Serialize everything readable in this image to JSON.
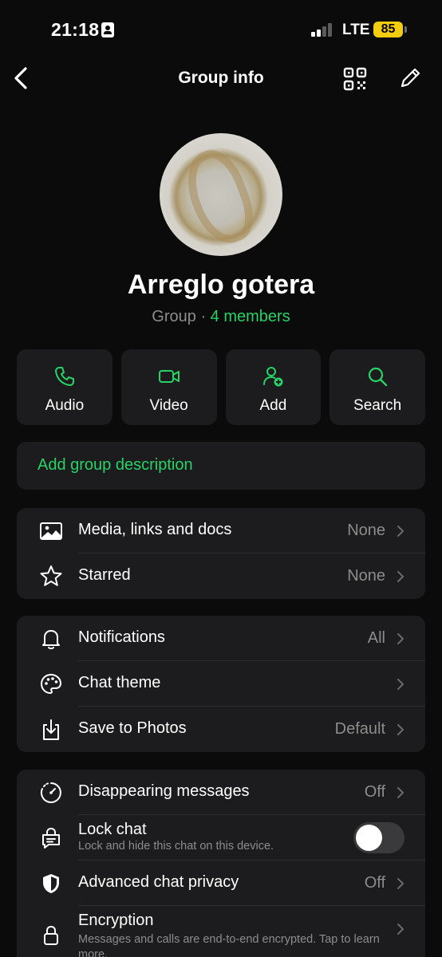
{
  "status_bar": {
    "time": "21:18",
    "network": "LTE",
    "battery": "85"
  },
  "header": {
    "title": "Group info"
  },
  "group": {
    "name": "Arreglo gotera",
    "type": "Group",
    "separator": "·",
    "members": "4 members"
  },
  "actions": [
    {
      "label": "Audio",
      "icon": "phone-icon"
    },
    {
      "label": "Video",
      "icon": "video-camera-icon"
    },
    {
      "label": "Add",
      "icon": "add-person-icon"
    },
    {
      "label": "Search",
      "icon": "search-icon"
    }
  ],
  "description": {
    "placeholder": "Add group description"
  },
  "media_section": {
    "media": {
      "label": "Media, links and docs",
      "value": "None"
    },
    "starred": {
      "label": "Starred",
      "value": "None"
    }
  },
  "settings_section": {
    "notifications": {
      "label": "Notifications",
      "value": "All"
    },
    "chat_theme": {
      "label": "Chat theme"
    },
    "save_to_photos": {
      "label": "Save to Photos",
      "value": "Default"
    }
  },
  "privacy_section": {
    "disappearing": {
      "label": "Disappearing messages",
      "value": "Off"
    },
    "lock_chat": {
      "label": "Lock chat",
      "sub": "Lock and hide this chat on this device.",
      "enabled": false
    },
    "advanced_privacy": {
      "label": "Advanced chat privacy",
      "value": "Off"
    },
    "encryption": {
      "label": "Encryption",
      "sub": "Messages and calls are end-to-end encrypted. Tap to learn more."
    }
  },
  "colors": {
    "accent": "#25d366",
    "background": "#0b0b0b",
    "card": "#1c1c1e",
    "secondary_text": "#8c8c8c",
    "battery": "#f5cd0f"
  }
}
